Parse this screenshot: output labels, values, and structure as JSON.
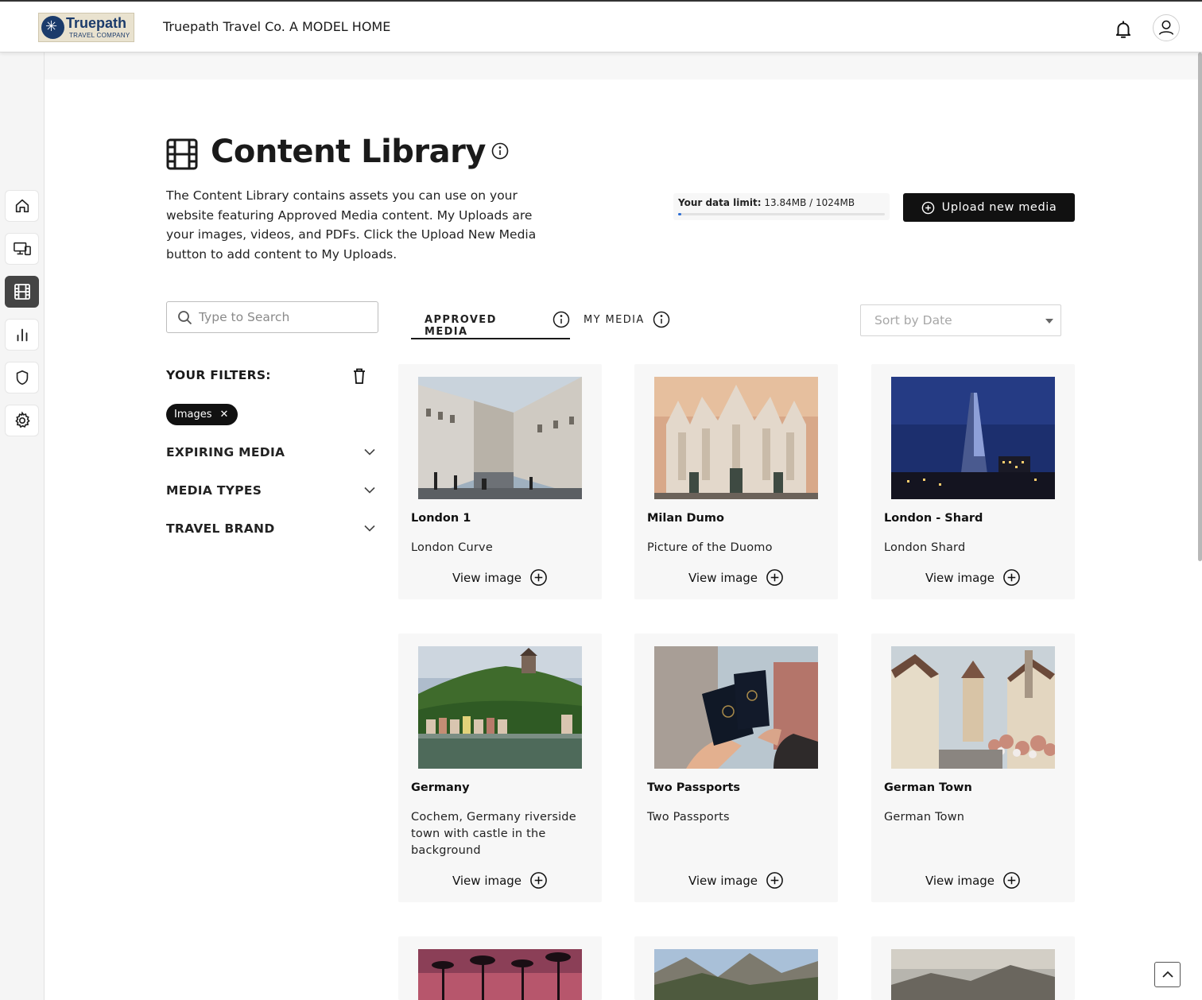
{
  "header": {
    "logo_name": "Truepath",
    "logo_sub": "TRAVEL COMPANY",
    "site_title": "Truepath Travel Co. A MODEL HOME"
  },
  "sidebar": {
    "items": [
      {
        "icon": "home-icon"
      },
      {
        "icon": "devices-icon"
      },
      {
        "icon": "film-icon",
        "active": true
      },
      {
        "icon": "chart-icon"
      },
      {
        "icon": "shield-icon"
      },
      {
        "icon": "gear-icon"
      }
    ]
  },
  "page": {
    "title": "Content Library",
    "description": "The Content Library contains assets you can use on your website featuring Approved Media content. My Uploads are your images, videos, and PDFs. Click the Upload New Media button to add content to My Uploads."
  },
  "data_limit": {
    "label": "Your data limit:",
    "value": "13.84MB / 1024MB",
    "fraction": 0.0135
  },
  "upload_button": {
    "label": "Upload new media"
  },
  "search": {
    "placeholder": "Type to Search",
    "value": ""
  },
  "filters": {
    "heading": "YOUR FILTERS:",
    "chip": "Images",
    "sections": [
      "EXPIRING MEDIA",
      "MEDIA TYPES",
      "TRAVEL BRAND"
    ]
  },
  "tabs": [
    {
      "label": "APPROVED MEDIA",
      "active": true
    },
    {
      "label": "MY MEDIA",
      "active": false
    }
  ],
  "sort": {
    "placeholder": "Sort by Date"
  },
  "cards": [
    {
      "title": "London 1",
      "description": "London Curve",
      "action": "View image"
    },
    {
      "title": "Milan Dumo",
      "description": "Picture of the Duomo",
      "action": "View image"
    },
    {
      "title": "London - Shard",
      "description": "London Shard",
      "action": "View image"
    },
    {
      "title": "Germany",
      "description": "Cochem, Germany riverside town with castle in the background",
      "action": "View image"
    },
    {
      "title": "Two Passports",
      "description": "Two Passports",
      "action": "View image"
    },
    {
      "title": "German Town",
      "description": "German Town",
      "action": "View image"
    }
  ],
  "colors": {
    "accent": "#111111",
    "progress": "#2c6ed5",
    "card_bg": "#f7f7f7"
  }
}
